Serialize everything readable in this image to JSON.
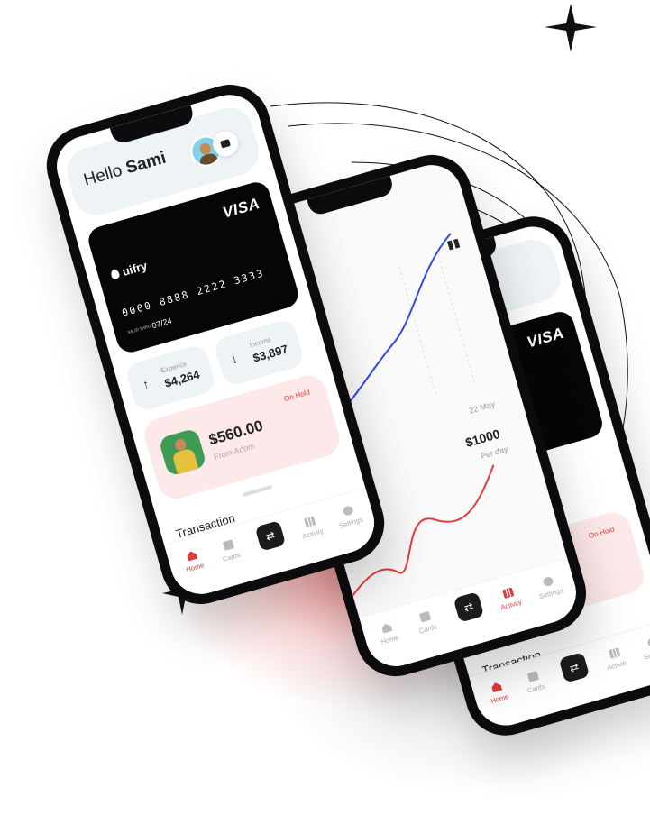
{
  "home": {
    "greeting_prefix": "Hello",
    "greeting_name": "Sami",
    "card": {
      "brand": "VISA",
      "logo_text": "uifry",
      "number": "0000 8888 2222 3333",
      "valid_thru_label": "VALID THRU",
      "valid_thru": "07/24"
    },
    "expense": {
      "label": "Expence",
      "value": "$4,264"
    },
    "income": {
      "label": "Income",
      "value": "$3,897"
    },
    "hold": {
      "tag": "On Hold",
      "amount": "$560.00",
      "from": "From Adom"
    },
    "section_title": "Transaction"
  },
  "activity": {
    "date": "22 May",
    "amount": "$1000",
    "per": "Per day"
  },
  "nav": {
    "home": "Home",
    "cards": "Cards",
    "activity": "Activity",
    "settings": "Settings",
    "swap_icon": "⇄"
  },
  "colors": {
    "accent": "#e23b3b",
    "card": "#060606",
    "chart_blue": "#3346e6",
    "soft_panel": "#eef3f6",
    "hold_panel": "#fde9e9"
  },
  "icons": [
    "avatar",
    "wallet-icon",
    "arrow-up-icon",
    "arrow-down-icon",
    "home-icon",
    "cards-icon",
    "swap-icon",
    "activity-icon",
    "settings-icon",
    "bar-chart-icon",
    "sparkle-icon"
  ]
}
